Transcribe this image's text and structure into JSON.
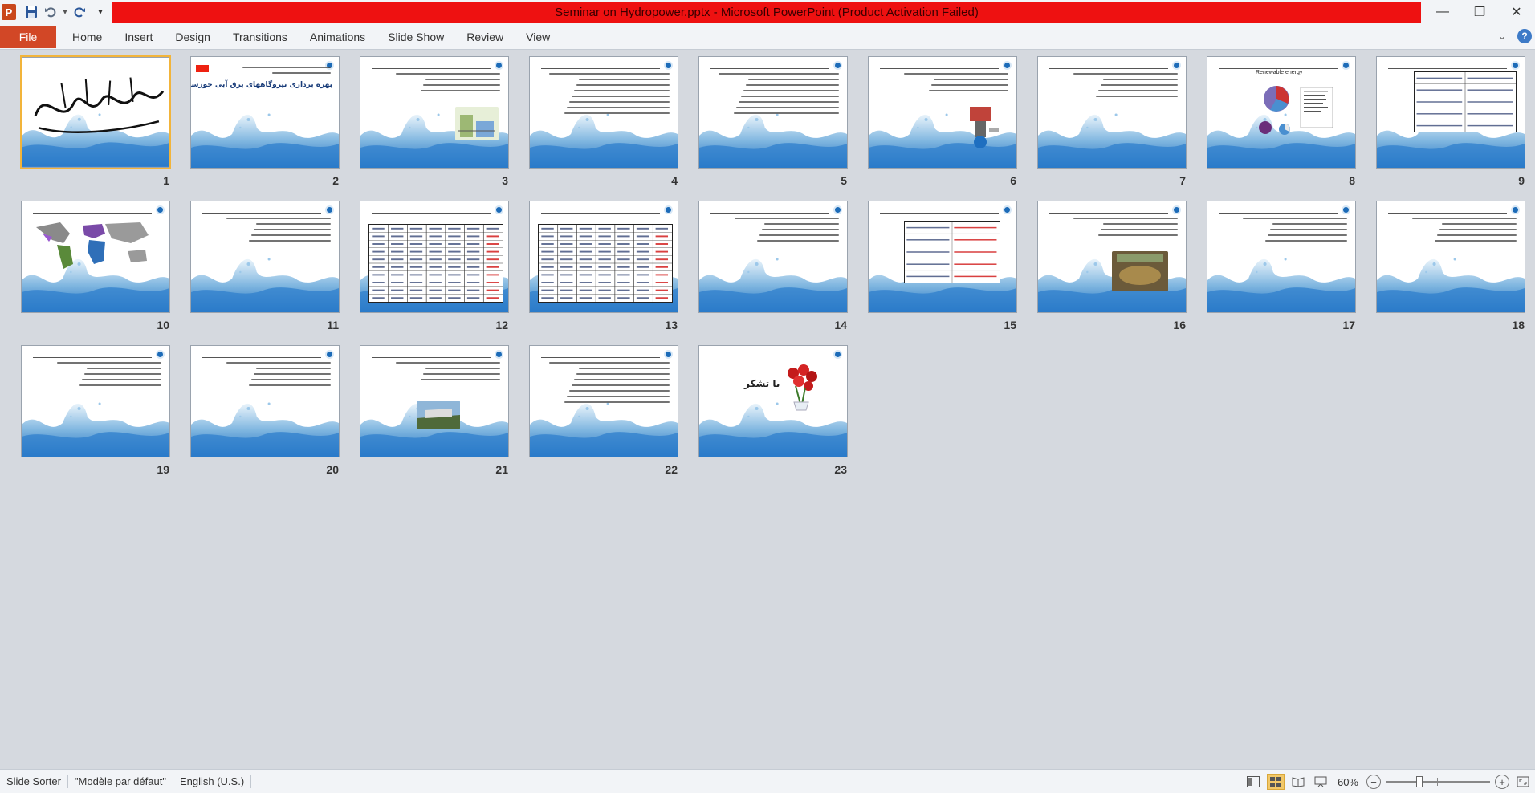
{
  "app": {
    "title": "Seminar on Hydropower.pptx  -  Microsoft PowerPoint (Product Activation Failed)",
    "logo_letter": "P",
    "accent": "#d24726",
    "title_bar_color": "#ee1111"
  },
  "quick_access": [
    {
      "name": "save-icon",
      "glyph": "💾"
    },
    {
      "name": "undo-icon",
      "glyph": "↶"
    },
    {
      "name": "undo-dropdown-icon",
      "glyph": "▾"
    },
    {
      "name": "redo-icon",
      "glyph": "↻"
    },
    {
      "name": "customize-qat-icon",
      "glyph": "⯆"
    }
  ],
  "ribbon": {
    "file_label": "File",
    "tabs": [
      "Home",
      "Insert",
      "Design",
      "Transitions",
      "Animations",
      "Slide Show",
      "Review",
      "View"
    ]
  },
  "window_controls": {
    "minimize": "—",
    "restore": "❐",
    "close": "✕"
  },
  "slides": [
    {
      "num": "1",
      "kind": "calligraphy",
      "selected": true
    },
    {
      "num": "2",
      "kind": "title",
      "title_text": "بهره برداری نیروگاههای برق آبی خوزستان"
    },
    {
      "num": "3",
      "kind": "bullets-image"
    },
    {
      "num": "4",
      "kind": "text"
    },
    {
      "num": "5",
      "kind": "text"
    },
    {
      "num": "6",
      "kind": "bullets-diagram"
    },
    {
      "num": "7",
      "kind": "text-short"
    },
    {
      "num": "8",
      "kind": "chart",
      "chart_title": "Renewable energy"
    },
    {
      "num": "9",
      "kind": "table-small"
    },
    {
      "num": "10",
      "kind": "map"
    },
    {
      "num": "11",
      "kind": "text-short"
    },
    {
      "num": "12",
      "kind": "table"
    },
    {
      "num": "13",
      "kind": "table"
    },
    {
      "num": "14",
      "kind": "text-short"
    },
    {
      "num": "15",
      "kind": "table-red"
    },
    {
      "num": "16",
      "kind": "text-photo"
    },
    {
      "num": "17",
      "kind": "text-short"
    },
    {
      "num": "18",
      "kind": "text-short"
    },
    {
      "num": "19",
      "kind": "text-short"
    },
    {
      "num": "20",
      "kind": "text-short"
    },
    {
      "num": "21",
      "kind": "text-photo2"
    },
    {
      "num": "22",
      "kind": "text"
    },
    {
      "num": "23",
      "kind": "thanks",
      "thanks_text": "با تشکر"
    }
  ],
  "status": {
    "view_label": "Slide Sorter",
    "theme": "\"Modèle par défaut\"",
    "language": "English (U.S.)",
    "zoom": "60%",
    "zoom_level": 0.6
  }
}
